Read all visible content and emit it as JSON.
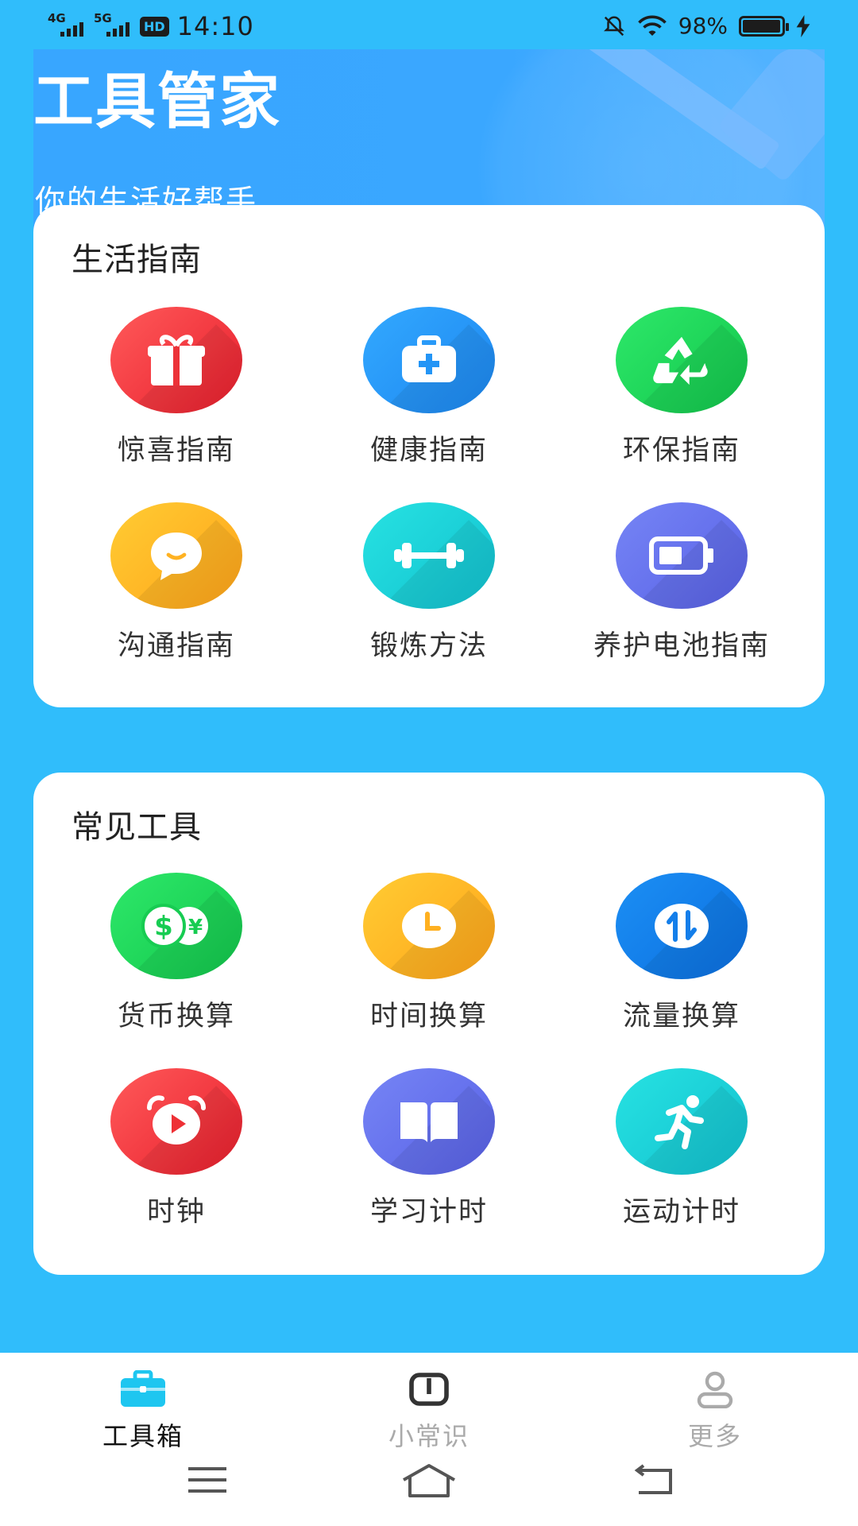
{
  "status_bar": {
    "network1": "4G",
    "network2": "5G",
    "hd": "HD",
    "time": "14:10",
    "battery_text": "98%",
    "battery_level": 0.98
  },
  "banner": {
    "title": "工具管家",
    "subtitle": "你的生活好帮手"
  },
  "life_guide": {
    "title": "生活指南",
    "items": [
      {
        "label": "惊喜指南",
        "icon": "gift-icon",
        "color": "#F03A3F"
      },
      {
        "label": "健康指南",
        "icon": "medical-kit-icon",
        "color": "#2A9BFA"
      },
      {
        "label": "环保指南",
        "icon": "recycle-icon",
        "color": "#1DD65A"
      },
      {
        "label": "沟通指南",
        "icon": "chat-bubble-icon",
        "color": "#FFB726"
      },
      {
        "label": "锻炼方法",
        "icon": "dumbbell-icon",
        "color": "#1CD2D8"
      },
      {
        "label": "养护电池指南",
        "icon": "battery-icon",
        "color": "#6672EE"
      }
    ]
  },
  "common_tools": {
    "title": "常见工具",
    "items": [
      {
        "label": "货币换算",
        "icon": "currency-exchange-icon",
        "color": "#1DD65A"
      },
      {
        "label": "时间换算",
        "icon": "clock-icon",
        "color": "#FFB726"
      },
      {
        "label": "流量换算",
        "icon": "data-transfer-icon",
        "color": "#137EEA"
      },
      {
        "label": "时钟",
        "icon": "alarm-clock-icon",
        "color": "#F03A3F"
      },
      {
        "label": "学习计时",
        "icon": "book-icon",
        "color": "#6672EE"
      },
      {
        "label": "运动计时",
        "icon": "runner-icon",
        "color": "#1CD2D8"
      }
    ]
  },
  "tabbar": {
    "tabs": [
      {
        "label": "工具箱",
        "icon": "toolbox-icon",
        "active": true,
        "color": "#111111"
      },
      {
        "label": "小常识",
        "icon": "book-open-icon",
        "active": false,
        "color": "#AAAAAA"
      },
      {
        "label": "更多",
        "icon": "user-icon",
        "active": false,
        "color": "#AAAAAA"
      }
    ]
  },
  "colors": {
    "background": "#30BDFB",
    "banner": "#3AA7FF",
    "card": "#FFFFFF"
  }
}
